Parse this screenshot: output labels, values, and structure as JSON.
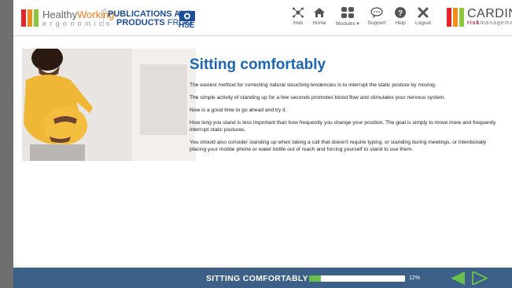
{
  "header": {
    "brand_title_prefix": "Healthy",
    "brand_title_suffix": "Working",
    "brand_registered": "®",
    "brand_subtitle": "ergonomics",
    "publisher_line1": "PUBLICATIONS AND",
    "publisher_line2_bold": "PRODUCTS",
    "publisher_line2_rest": " FROM",
    "hse_label": "HSE",
    "nav": [
      {
        "id": "hub",
        "label": "Hub",
        "icon": "hub-icon"
      },
      {
        "id": "home",
        "label": "Home",
        "icon": "home-icon"
      },
      {
        "id": "modules",
        "label": "Modules ▾",
        "icon": "modules-icon"
      },
      {
        "id": "support",
        "label": "Support",
        "icon": "support-icon"
      },
      {
        "id": "help",
        "label": "Help",
        "icon": "help-icon"
      },
      {
        "id": "logout",
        "label": "Logout",
        "icon": "close-icon"
      }
    ],
    "cardinus_name": "CARDINUS",
    "cardinus_sub_risk": "risk",
    "cardinus_sub_rest": "management"
  },
  "main": {
    "title": "Sitting comfortably",
    "paragraphs": [
      "The easiest method for correcting natural slouching tendencies is to interrupt the static posture by moving.",
      "The simple activity of standing up for a few seconds promotes blood flow and stimulates your nervous system.",
      "Now is a good time to go ahead and try it.",
      "How long you stand is less important than how frequently you change your position. The goal is simply to move more and frequently interrupt static postures.",
      "You should also consider standing up when taking a call that doesn't require typing, or standing during meetings, or intentionally placing your mobile phone or water bottle out of reach and forcing yourself to stand to use them."
    ]
  },
  "footer": {
    "section_title": "SITTING COMFORTABLY",
    "progress_percent": 12,
    "progress_label": "12%",
    "prev_icon": "arrow-left-icon",
    "next_icon": "arrow-right-icon"
  },
  "colors": {
    "accent_blue": "#1d66b3",
    "footer_bg": "#3c6087",
    "progress_green": "#6ac04c",
    "hw_orange": "#f07d1a",
    "cardinus_red": "#c21f2f"
  }
}
